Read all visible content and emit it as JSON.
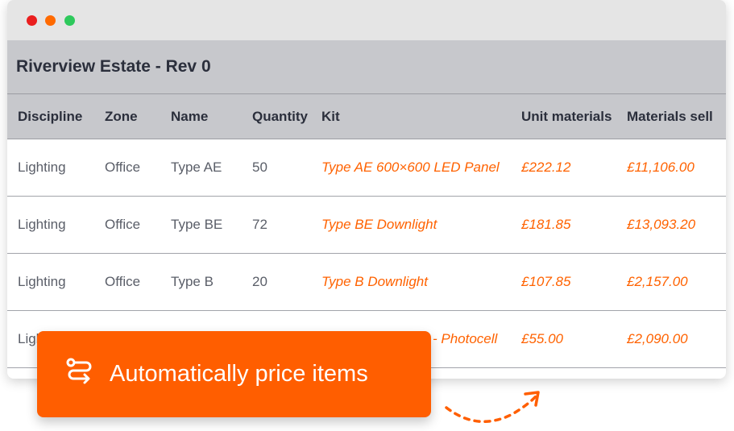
{
  "sheet": {
    "title": "Riverview Estate - Rev 0"
  },
  "columns": [
    "Discipline",
    "Zone",
    "Name",
    "Quantity",
    "Kit",
    "Unit materials",
    "Materials sell"
  ],
  "rows": [
    {
      "discipline": "Lighting",
      "zone": "Office",
      "name": "Type AE",
      "quantity": "50",
      "kit": "Type AE 600×600 LED Panel",
      "unit_materials": "£222.12",
      "materials_sell": "£11,106.00"
    },
    {
      "discipline": "Lighting",
      "zone": "Office",
      "name": "Type BE",
      "quantity": "72",
      "kit": "Type BE Downlight",
      "unit_materials": "£181.85",
      "materials_sell": "£13,093.20"
    },
    {
      "discipline": "Lighting",
      "zone": "Office",
      "name": "Type B",
      "quantity": "20",
      "kit": "Type B Downlight",
      "unit_materials": "£107.85",
      "materials_sell": "£2,157.00"
    },
    {
      "discipline": "Ligh",
      "kit": "- Photocell",
      "unit_materials": "£55.00",
      "materials_sell": "£2,090.00"
    }
  ],
  "callout": {
    "text": "Automatically price items",
    "icon": "route-icon"
  },
  "colors": {
    "accent": "#ff5e00",
    "header_bg": "#c7c8cc",
    "text_dark": "#2b2f3c"
  },
  "window_controls": [
    "close",
    "minimize",
    "maximize"
  ]
}
